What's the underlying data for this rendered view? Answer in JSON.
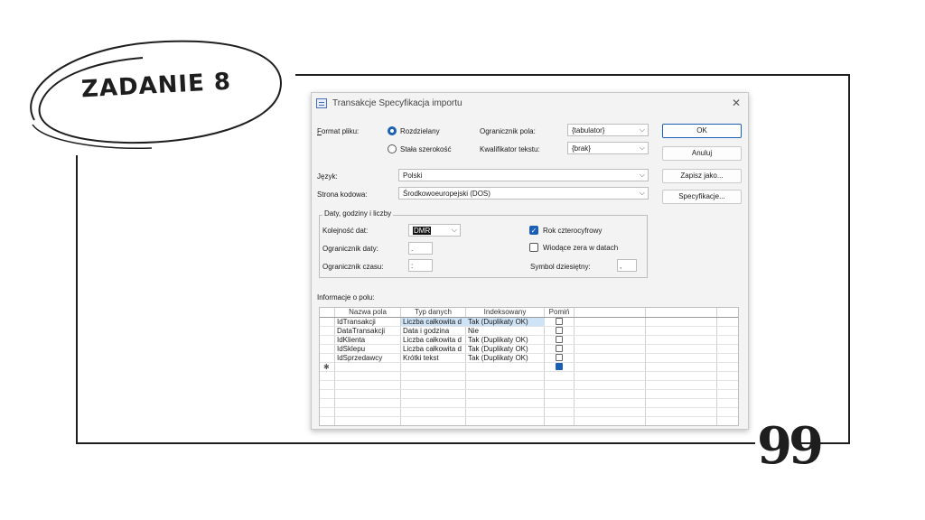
{
  "slide": {
    "title": "ZADANIE 8",
    "quote_mark": "99"
  },
  "dialog": {
    "title": "Transakcje Specyfikacja importu",
    "format_label_pre": "F",
    "format_label_rest": "ormat pliku:",
    "radio_delimited": "Rozdzielany",
    "radio_fixed": "Stała szerokość",
    "field_delim_label": "Ogranicznik pola:",
    "field_delim_value": "{tabulator}",
    "text_qual_label": "Kwalifikator tekstu:",
    "text_qual_value": "{brak}",
    "language_label": "Język:",
    "language_value": "Polski",
    "codepage_label": "Strona kodowa:",
    "codepage_value": "Środkowoeuropejski (DOS)",
    "group_title": "Daty, godziny i liczby",
    "date_order_label": "Kolejność dat:",
    "date_order_value": "DMR",
    "date_delim_label": "Ogranicznik daty:",
    "date_delim_value": ".",
    "time_delim_label": "Ogranicznik czasu:",
    "time_delim_value": ":",
    "four_digit_year": "Rok czterocyfrowy",
    "leading_zeros": "Wiodące zera w datach",
    "decimal_symbol_label": "Symbol dziesiętny:",
    "decimal_symbol_value": ",",
    "field_info_label": "Informacje o polu:",
    "buttons": {
      "ok": "OK",
      "cancel": "Anuluj",
      "save_as": "Zapisz jako...",
      "specs": "Specyfikacje..."
    },
    "grid": {
      "headers": [
        "Nazwa pola",
        "Typ danych",
        "Indeksowany",
        "Pomiń"
      ],
      "rows": [
        {
          "name": "IdTransakcji",
          "type": "Liczba całkowita d",
          "indexed": "Tak (Duplikaty OK)"
        },
        {
          "name": "DataTransakcji",
          "type": "Data i godzina",
          "indexed": "Nie"
        },
        {
          "name": "IdKlienta",
          "type": "Liczba całkowita d",
          "indexed": "Tak (Duplikaty OK)"
        },
        {
          "name": "IdSklepu",
          "type": "Liczba całkowita d",
          "indexed": "Tak (Duplikaty OK)"
        },
        {
          "name": "IdSprzedawcy",
          "type": "Krótki tekst",
          "indexed": "Tak (Duplikaty OK)"
        }
      ],
      "new_row_marker": "✱"
    }
  },
  "colors": {
    "accent": "#1a5fb4",
    "selection": "#cfe3f7"
  }
}
